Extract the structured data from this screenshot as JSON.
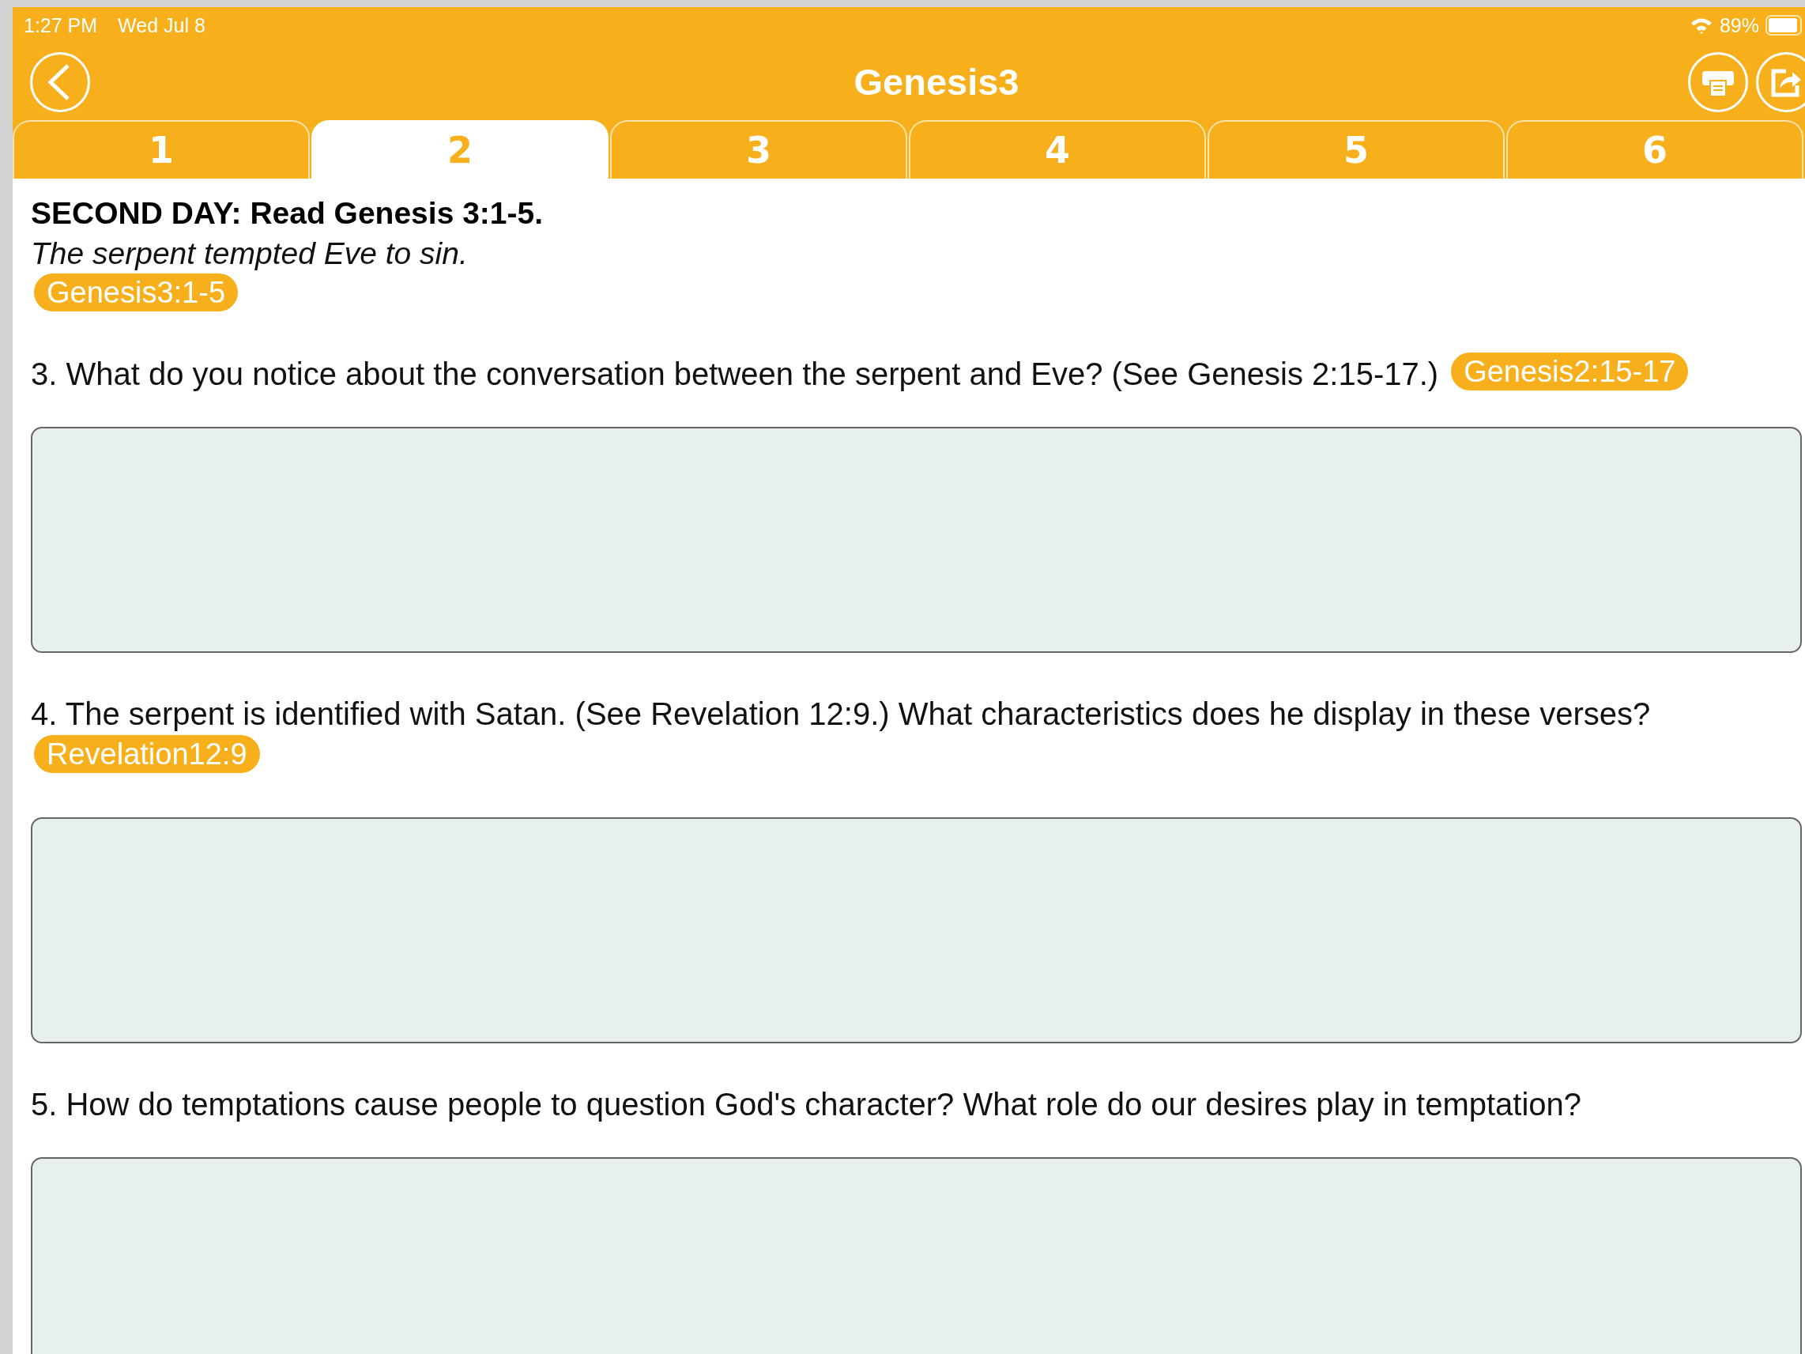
{
  "status_bar": {
    "time": "1:27 PM",
    "date": "Wed Jul 8",
    "battery": "89%"
  },
  "nav": {
    "title": "Genesis3"
  },
  "tabs": [
    {
      "label": "1",
      "selected": false
    },
    {
      "label": "2",
      "selected": true
    },
    {
      "label": "3",
      "selected": false
    },
    {
      "label": "4",
      "selected": false
    },
    {
      "label": "5",
      "selected": false
    },
    {
      "label": "6",
      "selected": false
    }
  ],
  "lesson": {
    "heading": "SECOND DAY: Read Genesis 3:1-5.",
    "summary": "The serpent tempted Eve to sin.",
    "reference": "Genesis3:1-5"
  },
  "questions": [
    {
      "text": "3. What do you notice about the conversation between the serpent and Eve? (See Genesis 2:15-17.)",
      "reference": "Genesis2:15-17",
      "kind": "inline"
    },
    {
      "text": "4. The serpent is identified with Satan. (See Revelation 12:9.) What characteristics does he display in these verses?",
      "reference": "Revelation12:9",
      "kind": "below"
    },
    {
      "text": "5. How do temptations cause people to question God's character? What role do our desires play in temptation?",
      "kind": "plain"
    }
  ]
}
